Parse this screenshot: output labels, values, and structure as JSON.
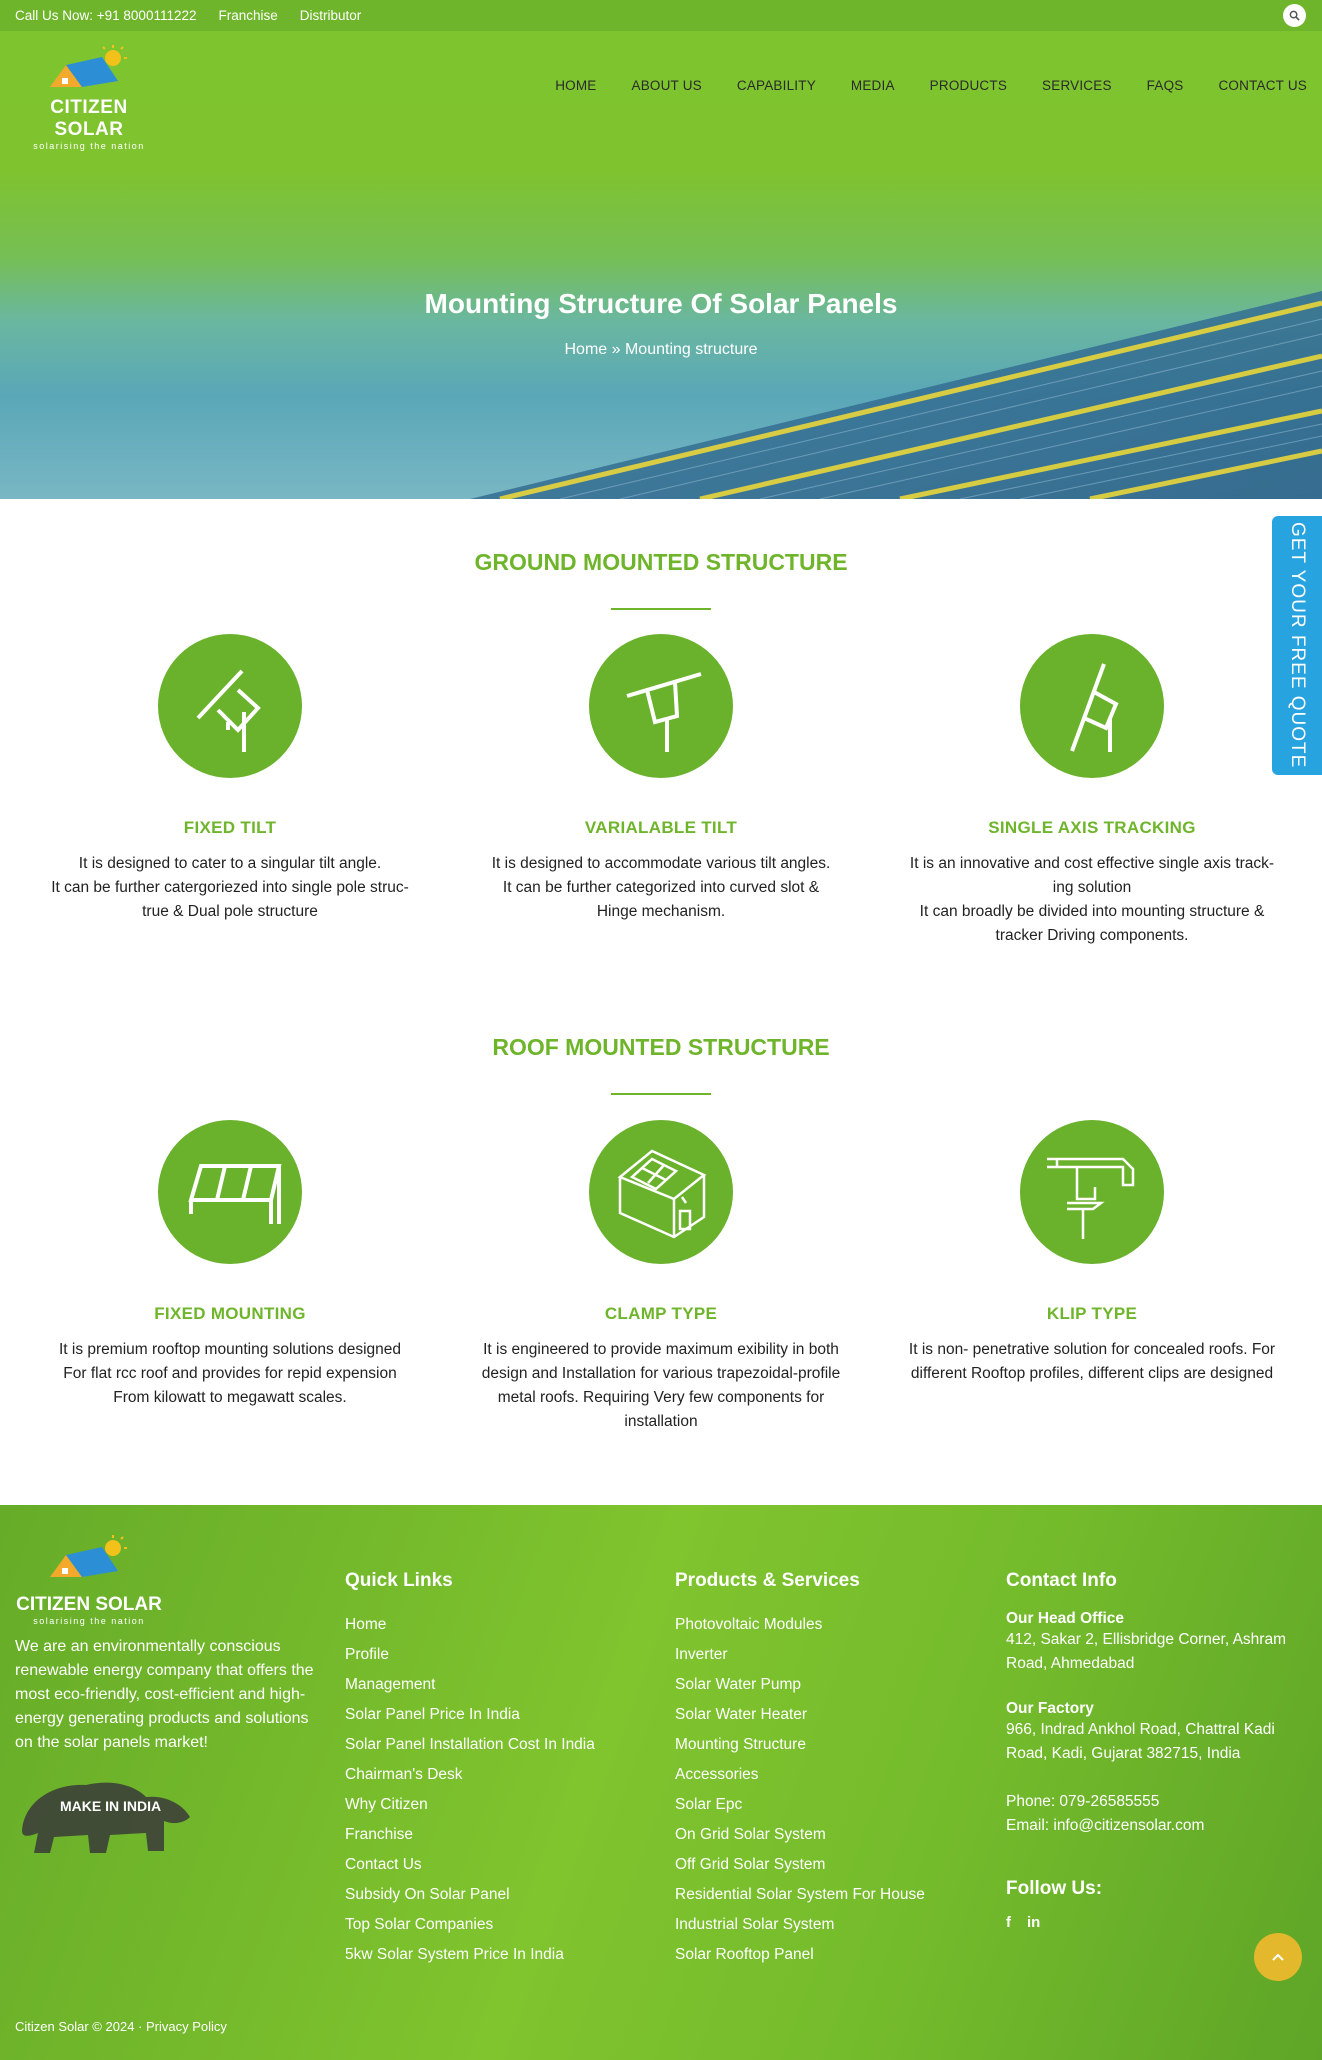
{
  "topbar": {
    "call": "Call Us Now: +91 8000111222",
    "franchise": "Franchise",
    "distributor": "Distributor"
  },
  "brand": {
    "name": "CITIZEN SOLAR",
    "tagline": "solarising the nation"
  },
  "nav": [
    "HOME",
    "ABOUT US",
    "CAPABILITY",
    "MEDIA",
    "PRODUCTS",
    "SERVICES",
    "FAQS",
    "CONTACT US"
  ],
  "hero": {
    "title": "Mounting Structure Of Solar Panels",
    "breadcrumb": "Home » Mounting structure"
  },
  "quote_tab": "GET YOUR FREE QUOTE",
  "ground": {
    "title": "GROUND MOUNTED STRUCTURE",
    "cards": [
      {
        "title": "FIXED TILT",
        "text": "It is designed to cater to a singular tilt angle.\nIt can be further catergoriezed into single pole struc-\ntrue & Dual pole structure",
        "icon": "fixed-tilt-icon"
      },
      {
        "title": "VARIALABLE TILT",
        "text": "It is designed to accommodate various tilt angles.\nIt can be further categorized into curved slot &\nHinge mechanism.",
        "icon": "variable-tilt-icon"
      },
      {
        "title": "SINGLE AXIS TRACKING",
        "text": "It is an innovative and cost effective single axis track-\ning solution\nIt can broadly be divided into mounting structure &\ntracker Driving components.",
        "icon": "single-axis-tracking-icon"
      }
    ]
  },
  "roof": {
    "title": "ROOF MOUNTED STRUCTURE",
    "cards": [
      {
        "title": "FIXED MOUNTING",
        "text": "It is premium rooftop mounting solutions designed\nFor flat rcc roof and provides for repid expension\nFrom kilowatt to megawatt scales.",
        "icon": "fixed-mounting-icon"
      },
      {
        "title": "CLAMP TYPE",
        "text": "It is engineered to provide maximum exibility in both\ndesign and Installation for various trapezoidal-profile\nmetal roofs. Requiring Very few components for\ninstallation",
        "icon": "clamp-type-icon"
      },
      {
        "title": "KLIP TYPE",
        "text": "It is non- penetrative solution for concealed roofs. For\ndifferent Rooftop profiles, different clips are designed",
        "icon": "klip-type-icon"
      }
    ]
  },
  "footer": {
    "about": "We are an environmentally conscious renewable energy company that offers the most eco-friendly, cost-efficient and high-energy generating products and solutions on the solar panels market!",
    "make_in_india": "MAKE IN INDIA",
    "quick_links_title": "Quick Links",
    "quick_links": [
      "Home",
      "Profile",
      "Management",
      "Solar Panel Price In India",
      "Solar Panel Installation Cost In India",
      "Chairman's Desk",
      "Why Citizen",
      "Franchise",
      "Contact Us",
      "Subsidy On Solar Panel",
      "Top Solar Companies",
      "5kw Solar System Price In India"
    ],
    "products_title": "Products & Services",
    "products": [
      "Photovoltaic Modules",
      "Inverter",
      "Solar Water Pump",
      "Solar Water Heater",
      "Mounting Structure",
      "Accessories",
      "Solar Epc",
      "On Grid Solar System",
      "Off Grid Solar System",
      "Residential Solar System For House",
      "Industrial Solar System",
      "Solar Rooftop Panel"
    ],
    "contact_title": "Contact Info",
    "head_office_label": "Our Head Office",
    "head_office": "412, Sakar 2, Ellisbridge Corner, Ashram Road, Ahmedabad",
    "factory_label": "Our Factory",
    "factory": "966, Indrad Ankhol Road, Chattral Kadi Road, Kadi, Gujarat 382715, India",
    "phone": "Phone: 079-26585555",
    "email": "Email: info@citizensolar.com",
    "follow": "Follow Us:",
    "social": [
      "f",
      "in"
    ],
    "copyright": "Citizen Solar © 2024 · Privacy Policy"
  }
}
